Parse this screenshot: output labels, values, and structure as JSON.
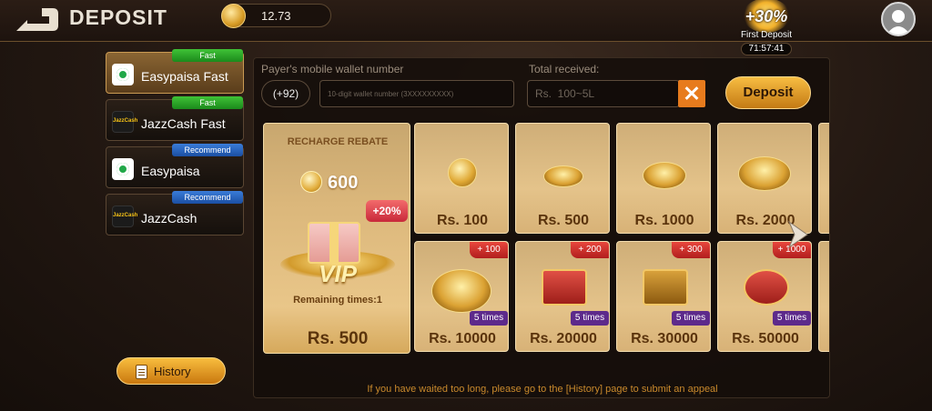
{
  "header": {
    "title": "DEPOSIT",
    "balance": "12.73",
    "promo": {
      "percent": "+30%",
      "label": "First Deposit",
      "timer": "71:57:41"
    }
  },
  "methods": [
    {
      "name": "Easypaisa Fast",
      "tag": "Fast",
      "logo": "easypaisa-logo"
    },
    {
      "name": "JazzCash Fast",
      "tag": "Fast",
      "logo": "jazzcash-logo"
    },
    {
      "name": "Easypaisa",
      "tag": "Recommend",
      "logo": "easypaisa-logo"
    },
    {
      "name": "JazzCash",
      "tag": "Recommend",
      "logo": "jazzcash-logo"
    }
  ],
  "jazz_logo_text": "JazzCash",
  "history_label": "History",
  "form": {
    "wallet_label": "Payer's mobile wallet number",
    "country_code": "(+92)",
    "wallet_placeholder": "10-digit wallet number (3XXXXXXXXX)",
    "total_label": "Total received:",
    "total_placeholder": "Rs.  100~5L",
    "deposit_label": "Deposit"
  },
  "rebate": {
    "title": "RECHARGE REBATE",
    "amount": "600",
    "badge": "+20%",
    "vip": "VIP",
    "remaining": "Remaining times:1",
    "price": "Rs. 500"
  },
  "amounts_top": [
    "Rs. 100",
    "Rs. 500",
    "Rs. 1000",
    "Rs. 2000"
  ],
  "amounts_bottom": [
    {
      "price": "Rs. 10000",
      "bonus": "+ 100",
      "times": "5 times"
    },
    {
      "price": "Rs. 20000",
      "bonus": "+ 200",
      "times": "5 times"
    },
    {
      "price": "Rs. 30000",
      "bonus": "+ 300",
      "times": "5 times"
    },
    {
      "price": "Rs. 50000",
      "bonus": "+ 1000",
      "times": "5 times"
    }
  ],
  "appeal_note": "If you have waited too long, please go to the [History] page to submit an appeal",
  "colors": {
    "accent": "#e9a833",
    "fast_tag": "#2fa52a",
    "recommend_tag": "#2a65c0",
    "bonus": "#d8302c",
    "times": "#5d2a8b"
  }
}
